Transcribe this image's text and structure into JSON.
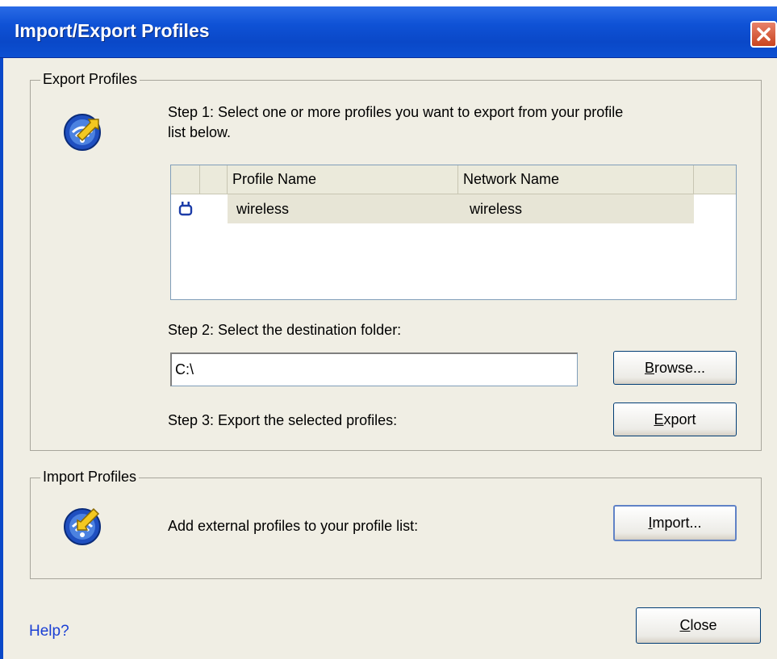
{
  "window": {
    "title": "Import/Export Profiles"
  },
  "export_group": {
    "title": "Export Profiles",
    "step1": "Step 1: Select one or more profiles you want to export from your profile",
    "step1_cont": "list below.",
    "columns": [
      "Profile Name",
      "Network Name"
    ],
    "rows": [
      {
        "profile": "wireless",
        "network": "wireless",
        "icon": "network-adapter-icon"
      }
    ],
    "step2": "Step 2: Select the destination folder:",
    "destination_value": "C:\\",
    "browse_label_key": "B",
    "browse_label_rest": "rowse...",
    "step3": "Step 3: Export the selected profiles:",
    "export_label_key": "E",
    "export_label_rest": "xport"
  },
  "import_group": {
    "title": "Import Profiles",
    "description": "Add external profiles to your profile list:",
    "import_label_key": "I",
    "import_label_rest": "mport..."
  },
  "footer": {
    "help_label": "Help?",
    "close_label_key": "C",
    "close_label_rest": "lose"
  },
  "icons": {
    "export": "export-profile-icon",
    "import": "import-profile-icon",
    "close": "close-icon"
  },
  "colors": {
    "titlebar": "#0a48c8",
    "close_button": "#d65a36",
    "dialog_bg": "#f0eee4",
    "help_link": "#1a3fd4"
  }
}
